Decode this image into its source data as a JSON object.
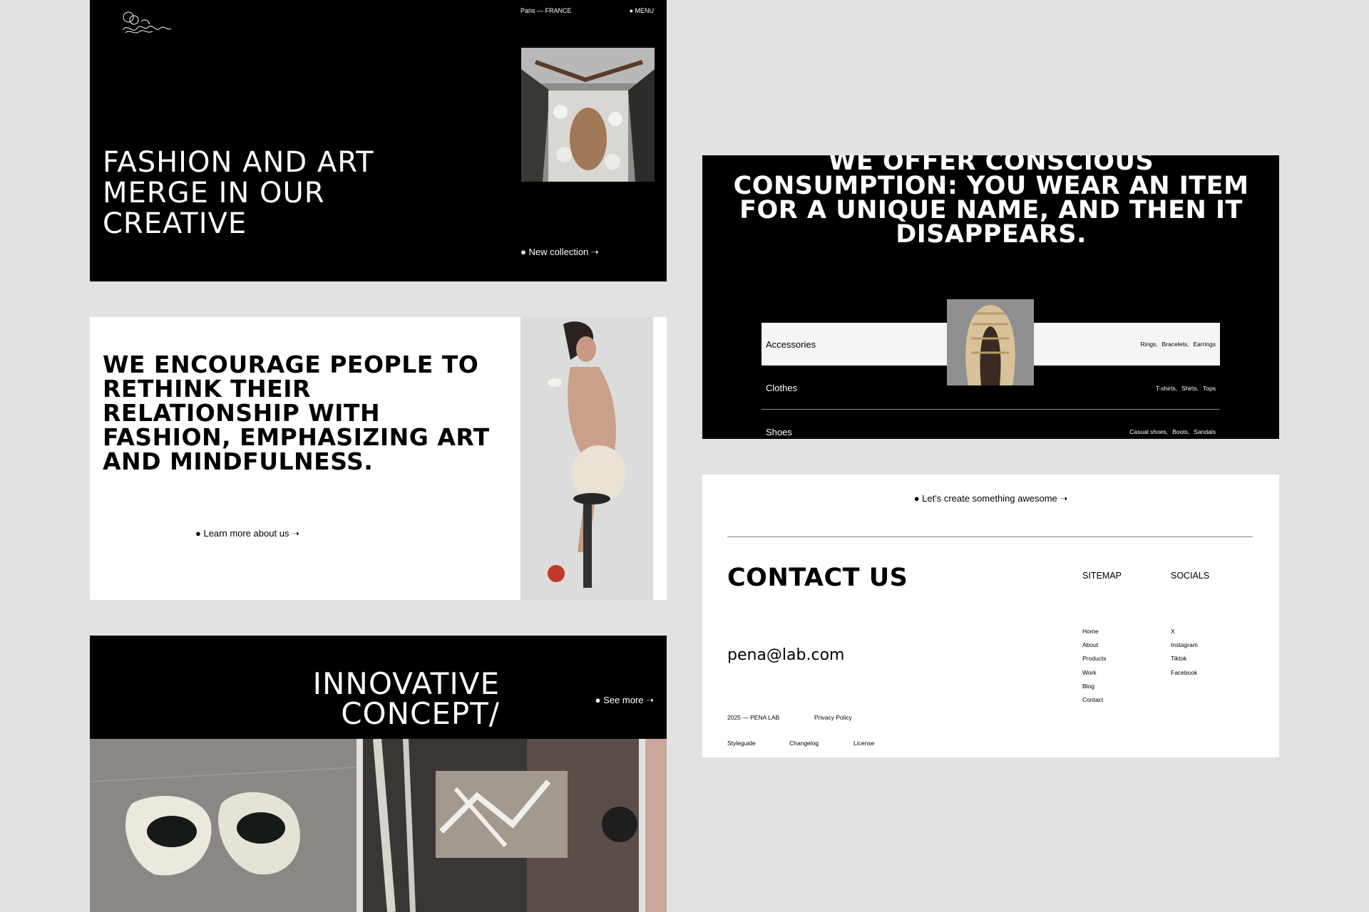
{
  "colors": {
    "background": "#e2e2e2",
    "black": "#000000",
    "white": "#ffffff"
  },
  "hero": {
    "location": "Paris — FRANCE",
    "menu": "● MENU",
    "headline": "FASHION AND ART MERGE IN OUR CREATIVE",
    "cta": "● New collection ➝"
  },
  "about": {
    "headline": "WE ENCOURAGE PEOPLE TO RETHINK THEIR RELATIONSHIP WITH FASHION, EMPHASIZING ART AND MINDFULNESS.",
    "cta": "● Learn more about us ➝"
  },
  "concept": {
    "headline": "INNOVATIVE CONCEPT/",
    "cta": "● See more ➝"
  },
  "categories": {
    "headline": "WE OFFER CONSCIOUS CONSUMPTION: YOU WEAR AN ITEM FOR A UNIQUE NAME, AND THEN IT DISAPPEARS.",
    "rows": [
      {
        "name": "Accessories",
        "subs": [
          "Rings,",
          "Bracelets,",
          "Earrings"
        ]
      },
      {
        "name": "Clothes",
        "subs": [
          "T-shirts,",
          "Shirts,",
          "Tops"
        ]
      },
      {
        "name": "Shoes",
        "subs": [
          "Casual shoes,",
          "Boots,",
          "Sandals"
        ]
      }
    ]
  },
  "contact": {
    "cta": "● Let's create something awesome ➝",
    "headline": "CONTACT US",
    "email": "pena@lab.com",
    "sitemap_title": "SITEMAP",
    "sitemap": [
      "Home",
      "About",
      "Products",
      "Work",
      "Blog",
      "Contact"
    ],
    "socials_title": "SOCIALS",
    "socials": [
      "X",
      "Instagram",
      "Tiktok",
      "Facebook"
    ],
    "copyright": "2025 — PENA LAB",
    "privacy": "Privacy Policy",
    "styleguide": "Styleguide",
    "changelog": "Changelog",
    "license": "License"
  }
}
